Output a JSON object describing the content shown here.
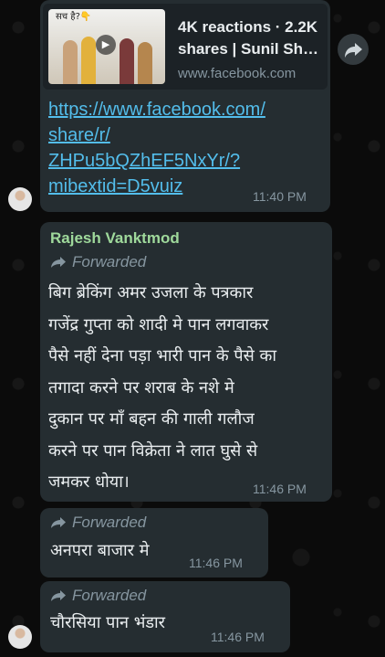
{
  "link_preview": {
    "thumb_caption": "सच है?👇",
    "title_line1": "4K reactions · 2.2K",
    "title_line2": "shares | Sunil Shar...",
    "domain": "www.facebook.com"
  },
  "link_message": {
    "lines": [
      "https://www.facebook.com/",
      "share/r/",
      "ZHPu5bQZhEF5NxYr/?",
      "mibextid=D5vuiz"
    ],
    "time": "11:40 PM"
  },
  "message_2": {
    "sender": "Rajesh Vanktmod",
    "forwarded_label": "Forwarded",
    "lines": [
      "बिग ब्रेकिंग अमर उजला के पत्रकार",
      "गजेंद्र गुप्ता को शादी मे पान लगवाकर",
      "पैसे नहीं देना पड़ा भारी पान के पैसे का",
      "तगादा करने पर शराब के नशे मे",
      "दुकान पर माँ बहन की गाली गलौज",
      "करने पर पान विक्रेता ने लात घुसे से",
      "जमकर धोया।"
    ],
    "time": "11:46 PM"
  },
  "message_3": {
    "forwarded_label": "Forwarded",
    "text": "अनपरा बाजार मे",
    "time": "11:46 PM"
  },
  "message_4": {
    "forwarded_label": "Forwarded",
    "text": "चौरसिया पान भंडार",
    "time": "11:46 PM"
  },
  "colors": {
    "background": "#0b0b0b",
    "bubble": "#252d31",
    "link": "#53bdeb",
    "sender_name": "#9fd99b",
    "meta_text": "#8696a0"
  }
}
